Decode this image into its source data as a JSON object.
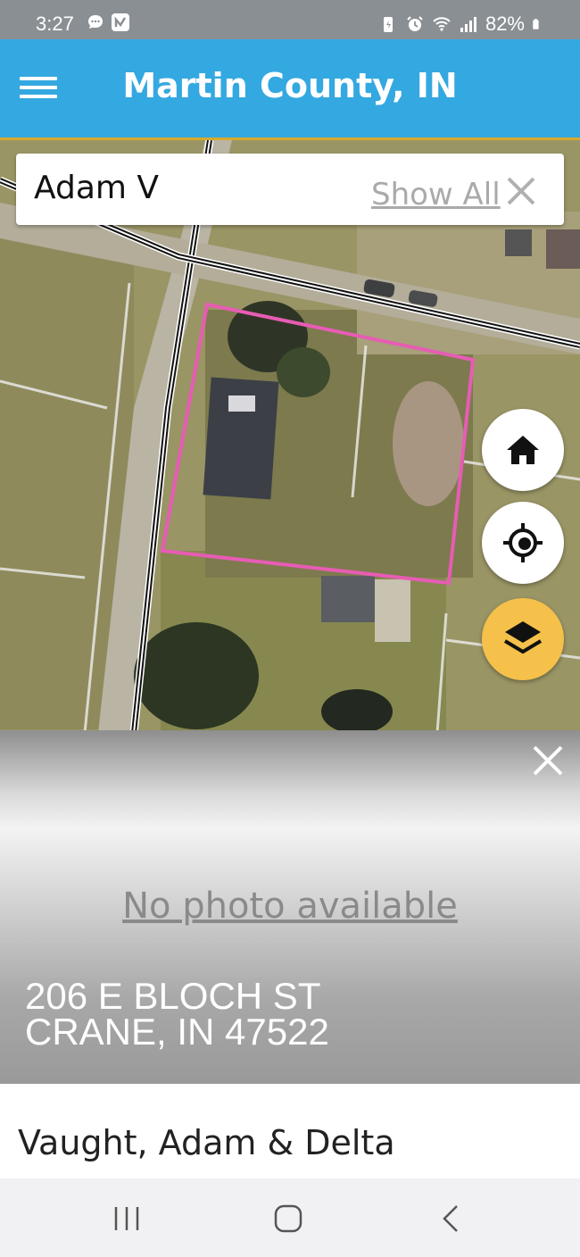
{
  "status_bar": {
    "time": "3:27",
    "battery_percent": "82%",
    "left_icons": [
      "chat-icon",
      "n-app-icon"
    ],
    "right_icons": [
      "battery-saver-icon",
      "alarm-icon",
      "wifi-icon",
      "signal-icon",
      "battery-icon"
    ]
  },
  "app_bar": {
    "title": "Martin County, IN",
    "color": "#34a8e0",
    "menu_icon": "hamburger-menu-icon"
  },
  "search": {
    "query": "Adam V",
    "show_all_label": "Show All",
    "close_icon": "close-icon"
  },
  "map": {
    "parcel_outline_color": "#e75cb4",
    "fabs": [
      {
        "name": "home",
        "icon": "home-icon"
      },
      {
        "name": "locate",
        "icon": "locate-icon"
      },
      {
        "name": "layers",
        "icon": "layers-icon",
        "color": "#f5c14a"
      }
    ]
  },
  "parcel": {
    "photo_text": "No photo available",
    "address_line1": "206 E BLOCH ST",
    "address_line2": "CRANE, IN 47522",
    "owner": "Vaught, Adam & Delta"
  },
  "nav_bar": {
    "buttons": [
      "recent-apps-icon",
      "home-nav-icon",
      "back-icon"
    ]
  }
}
